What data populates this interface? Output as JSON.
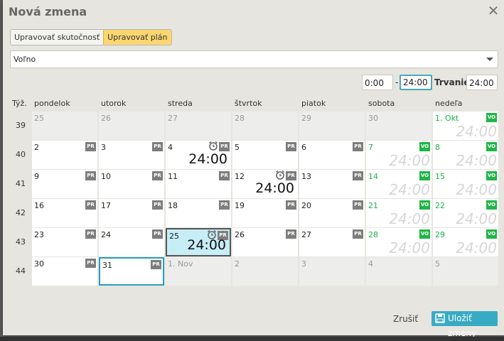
{
  "dialog": {
    "title": "Nová zmena",
    "close_label": "✕"
  },
  "mode_tabs": [
    {
      "label": "Upravovať skutočnosť",
      "active": false
    },
    {
      "label": "Upravovať plán",
      "active": true
    }
  ],
  "shift_select": {
    "value": "Voľno"
  },
  "time": {
    "from": "0:00",
    "dash": "-",
    "to": "24:00",
    "duration_label": "Trvanie",
    "duration": "24:00"
  },
  "calendar": {
    "week_header": "Týž.",
    "day_headers": [
      "pondelok",
      "utorok",
      "streda",
      "štvrtok",
      "piatok",
      "sobota",
      "nedeľa"
    ],
    "badge_pr": "PR",
    "badge_vo": "VO",
    "ghost_hours": "24:00",
    "weeks": [
      {
        "week": "39",
        "days": [
          {
            "label": "25",
            "other": true
          },
          {
            "label": "26",
            "other": true
          },
          {
            "label": "27",
            "other": true
          },
          {
            "label": "28",
            "other": true
          },
          {
            "label": "29",
            "other": true
          },
          {
            "label": "30",
            "other": true
          },
          {
            "label": "1. Okt",
            "green": true,
            "badge": "VO",
            "ghost": true
          }
        ]
      },
      {
        "week": "40",
        "days": [
          {
            "label": "2",
            "badge": "PR"
          },
          {
            "label": "3",
            "badge": "PR"
          },
          {
            "label": "4",
            "badge": "PR",
            "alarm": true,
            "hours": "24:00"
          },
          {
            "label": "5",
            "badge": "PR"
          },
          {
            "label": "6",
            "badge": "PR"
          },
          {
            "label": "7",
            "green": true,
            "badge": "VO",
            "ghost": true
          },
          {
            "label": "8",
            "green": true,
            "badge": "VO",
            "ghost": true
          }
        ]
      },
      {
        "week": "41",
        "days": [
          {
            "label": "9",
            "badge": "PR"
          },
          {
            "label": "10",
            "badge": "PR"
          },
          {
            "label": "11",
            "badge": "PR"
          },
          {
            "label": "12",
            "badge": "PR",
            "alarm": true,
            "hours": "24:00"
          },
          {
            "label": "13",
            "badge": "PR"
          },
          {
            "label": "14",
            "green": true,
            "badge": "VO",
            "ghost": true
          },
          {
            "label": "15",
            "green": true,
            "badge": "VO",
            "ghost": true
          }
        ]
      },
      {
        "week": "42",
        "days": [
          {
            "label": "16",
            "badge": "PR"
          },
          {
            "label": "17",
            "badge": "PR"
          },
          {
            "label": "18",
            "badge": "PR"
          },
          {
            "label": "19",
            "badge": "PR"
          },
          {
            "label": "20",
            "badge": "PR"
          },
          {
            "label": "21",
            "green": true,
            "badge": "VO",
            "ghost": true
          },
          {
            "label": "22",
            "green": true,
            "badge": "VO",
            "ghost": true
          }
        ]
      },
      {
        "week": "43",
        "days": [
          {
            "label": "23",
            "badge": "PR"
          },
          {
            "label": "24",
            "badge": "PR"
          },
          {
            "label": "25",
            "badge": "PR",
            "alarm": true,
            "hours": "24:00",
            "selected": true
          },
          {
            "label": "26",
            "badge": "PR"
          },
          {
            "label": "27",
            "badge": "PR"
          },
          {
            "label": "28",
            "green": true,
            "badge": "VO",
            "ghost": true
          },
          {
            "label": "29",
            "green": true,
            "badge": "VO",
            "ghost": true
          }
        ]
      },
      {
        "week": "44",
        "days": [
          {
            "label": "30",
            "badge": "PR"
          },
          {
            "label": "31",
            "badge": "PR",
            "today": true
          },
          {
            "label": "1. Nov",
            "other": true
          },
          {
            "label": "2",
            "other": true
          },
          {
            "label": "3",
            "other": true
          },
          {
            "label": "4",
            "other": true
          },
          {
            "label": "5",
            "other": true
          }
        ]
      }
    ]
  },
  "footer": {
    "cancel_label": "Zrušiť",
    "save_label": "Uložiť zmeny"
  },
  "colors": {
    "accent": "#38abc4",
    "plan_active": "#fbd671",
    "weekend_green": "#1db24b",
    "badge_pr": "#7d7d7d",
    "badge_vo": "#20b547"
  }
}
